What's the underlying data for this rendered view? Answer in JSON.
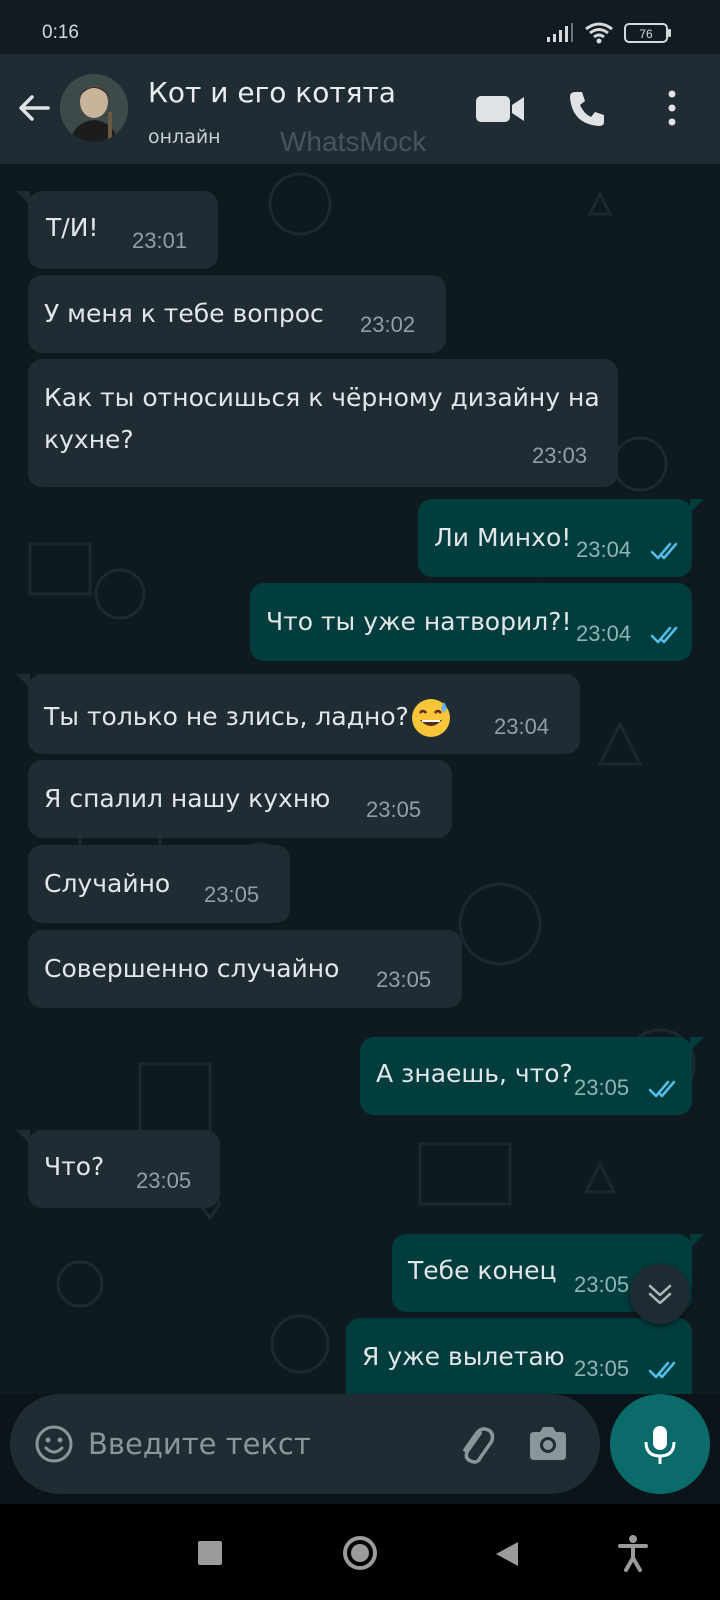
{
  "status_bar": {
    "time": "0:16",
    "battery": "76"
  },
  "header": {
    "title": "Кот и его котята",
    "status": "онлайн",
    "watermark": "WhatsMock"
  },
  "messages": [
    {
      "direction": "in",
      "text": "Т/И!",
      "time": "23:01"
    },
    {
      "direction": "in",
      "text": "У меня к тебе вопрос",
      "time": "23:02"
    },
    {
      "direction": "in",
      "text_line1": "Как ты относишься к чёрному дизайну на",
      "text_line2": "кухне?",
      "time": "23:03"
    },
    {
      "direction": "out",
      "text": "Ли Минхо!",
      "time": "23:04",
      "status": "read"
    },
    {
      "direction": "out",
      "text": "Что ты уже натворил?!",
      "time": "23:04",
      "status": "read"
    },
    {
      "direction": "in",
      "text": "Ты только не злись, ладно?",
      "emoji": "sweat-smile-emoji",
      "time": "23:04"
    },
    {
      "direction": "in",
      "text": "Я спалил нашу кухню",
      "time": "23:05"
    },
    {
      "direction": "in",
      "text": "Случайно",
      "time": "23:05"
    },
    {
      "direction": "in",
      "text": "Совершенно случайно",
      "time": "23:05"
    },
    {
      "direction": "out",
      "text": "А знаешь, что?",
      "time": "23:05",
      "status": "read"
    },
    {
      "direction": "in",
      "text": "Что?",
      "time": "23:05"
    },
    {
      "direction": "out",
      "text": "Тебе конец",
      "time": "23:05",
      "status": "read"
    },
    {
      "direction": "out",
      "text": "Я уже вылетаю",
      "time": "23:05",
      "status": "read"
    }
  ],
  "input": {
    "placeholder": "Введите текст"
  },
  "colors": {
    "incoming_bubble": "#1f2c34",
    "outgoing_bubble": "#013d3d",
    "read_ticks": "#53bdeb",
    "mic_button": "#0b6b6a"
  }
}
